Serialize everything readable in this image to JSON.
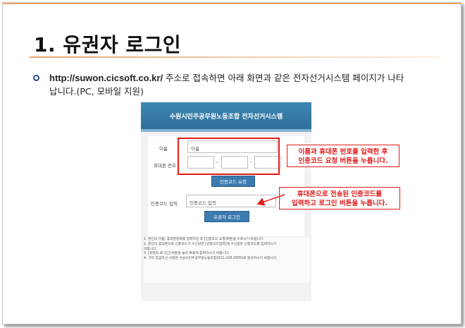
{
  "slide": {
    "title": "1. 유권자 로그인",
    "bullet_url": "http://suwon.cicsoft.co.kr/",
    "bullet_rest_1": " 주소로 접속하면 아래 화면과 같은 전자선거시스템 페이지가 나타",
    "bullet_rest_2": "납니다.(PC, 모바일 지원)"
  },
  "screenshot": {
    "header_title": "수원시민주공무원노동조합 전자선거시스템",
    "name_label": "이름",
    "name_placeholder": "이름",
    "phone_label": "휴대폰 번호",
    "dash": "-",
    "request_button": "인증코드 요청",
    "code_label": "인증코드 입력",
    "code_placeholder": "인증코드 입력",
    "login_button": "유권자 로그인",
    "notes": [
      "1. 본인의 이름, 휴대폰번호를 입력하신 후 [인증코드 요청]버튼을 누르시기 바랍니다.",
      "2. 본인의 휴대폰으로 인증코드가 수신되면 [인증코드입력]에 수신받은 인증코드를 입력하시기",
      "   바랍니다.",
      "3. [유권자 로그인] 버튼을 눌러 투표에 참여하시기 바랍니다.",
      "4. 기타 궁금하신 사항은 수원시민주공무원노동조합(031-228-2909)로 문의하시기 바랍니다."
    ]
  },
  "callouts": {
    "first_line1": "이름과 휴대폰 번호를 입력한 후",
    "first_line2": "인증코드 요청 버튼을 누릅니다.",
    "second_line1": "휴대폰으로 전송된 인증코드를",
    "second_line2": "입력하고 로그인 버튼을 누릅니다."
  },
  "colors": {
    "accent_red": "#e11b1b",
    "header_blue": "#2f6f9a",
    "button_blue": "#3b7bb0",
    "title_underline": "#e6a26a"
  }
}
